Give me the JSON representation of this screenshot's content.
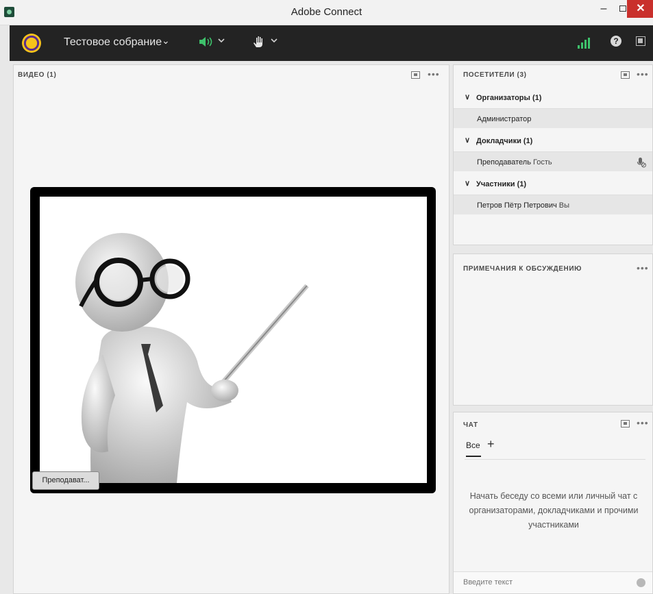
{
  "window": {
    "title": "Adobe Connect",
    "minimize": "–",
    "close": "✕"
  },
  "toolbar": {
    "meeting_name": "Тестовое собрание",
    "chevron": "⌄",
    "speaker_icon": "speaker-icon",
    "hand_icon": "raise-hand-icon",
    "help": "?"
  },
  "video_pod": {
    "title": "ВИДЕО (1)",
    "more": "•••",
    "name_tag": "Преподават..."
  },
  "attendees_pod": {
    "title": "ПОСЕТИТЕЛИ (3)",
    "more": "•••",
    "groups": [
      {
        "label": "Организаторы (1)",
        "members": [
          {
            "name": "Администратор",
            "tag": ""
          }
        ]
      },
      {
        "label": "Докладчики (1)",
        "members": [
          {
            "name": "Преподаватель",
            "tag": "Гость"
          }
        ]
      },
      {
        "label": "Участники (1)",
        "members": [
          {
            "name": "Петров Пётр Петрович",
            "tag": "Вы"
          }
        ]
      }
    ]
  },
  "notes_pod": {
    "title": "ПРИМЕЧАНИЯ К ОБСУЖДЕНИЮ",
    "more": "•••"
  },
  "chat_pod": {
    "title": "ЧАТ",
    "more": "•••",
    "tab_all": "Все",
    "add_tab": "+",
    "empty_message": "Начать беседу со всеми или личный чат с организаторами, докладчиками и прочими участниками",
    "input_placeholder": "Введите текст"
  },
  "colors": {
    "toolbar_bg": "#232323",
    "accent_green": "#3ec16b",
    "close_red": "#c9302c"
  }
}
